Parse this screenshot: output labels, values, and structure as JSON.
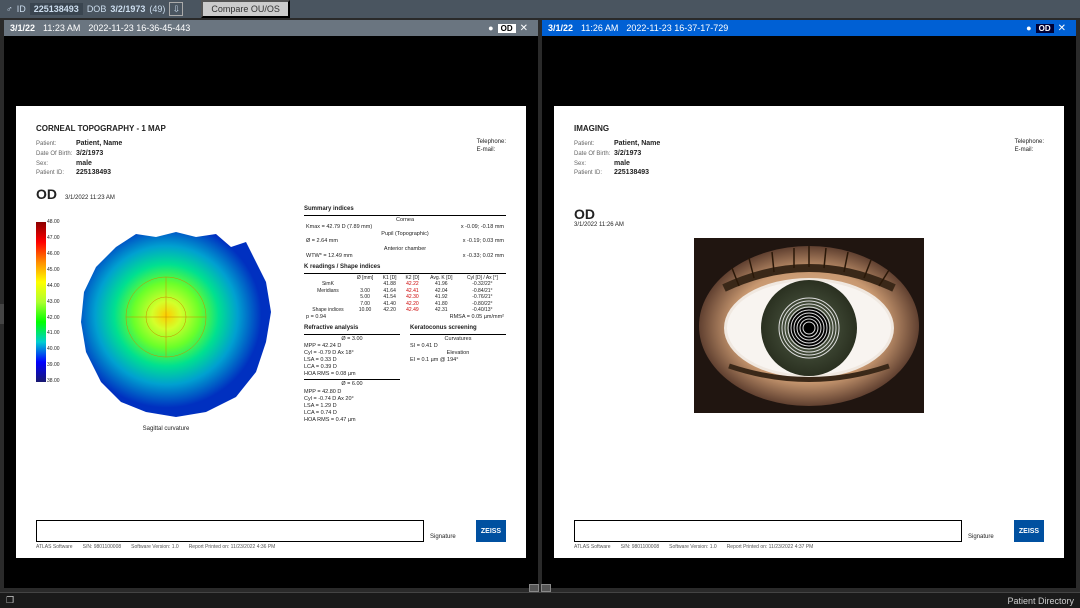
{
  "topbar": {
    "gender_icon": "♂",
    "id_label": "ID",
    "id": "225138493",
    "dob_label": "DOB",
    "dob": "3/2/1973",
    "age": "(49)",
    "compare_btn": "Compare OU/OS"
  },
  "panel1": {
    "tab_date": "3/1/22",
    "tab_time": "11:23 AM",
    "tab_file": "2022-11-23 16-36-45-443",
    "eye_ind": "OD",
    "report": {
      "title": "CORNEAL TOPOGRAPHY - 1 MAP",
      "patient_label": "Patient:",
      "patient": "Patient, Name",
      "dob_label": "Date Of Birth:",
      "dob": "3/2/1973",
      "sex_label": "Sex:",
      "sex": "male",
      "pid_label": "Patient ID:",
      "pid": "225138493",
      "tel_label": "Telephone:",
      "email_label": "E-mail:",
      "eye": "OD",
      "ts": "3/1/2022 11:23 AM",
      "colorbar": [
        "48.00",
        "47.00",
        "46.00",
        "45.00",
        "44.00",
        "43.00",
        "42.00",
        "41.00",
        "40.00",
        "39.00",
        "38.00"
      ],
      "summary": {
        "title": "Summary indices",
        "cornea": "Cornea",
        "kmax": "Kmax = 42.79 D (7.89 mm)",
        "kmax_v": "x -0.09; -0.18 mm",
        "pupil": "Pupil (Topographic)",
        "diam": "Ø = 2.64 mm",
        "diam_v": "x -0.19; 0.03 mm",
        "ant": "Anterior chamber",
        "wtw": "WTW* = 12.49 mm",
        "wtw_v": "x -0.33; 0.02 mm"
      },
      "kread": {
        "title": "K readings / Shape indices",
        "headers": [
          "",
          "Ø [mm]",
          "K1 [D]",
          "K2 [D]",
          "Avg. K [D]",
          "Cyl [D] / Ax [°]"
        ],
        "rows": [
          [
            "SimK",
            "",
            "41.88",
            "42.22",
            "41.96",
            "-0.32/22°"
          ],
          [
            "Meridians",
            "3.00",
            "41.64",
            "42.41",
            "42.04",
            "-0.84/21°"
          ],
          [
            "",
            "5.00",
            "41.54",
            "42.30",
            "41.92",
            "-0.76/21°"
          ],
          [
            "",
            "7.00",
            "41.40",
            "42.20",
            "41.80",
            "-0.80/22°"
          ],
          [
            "Shape indices",
            "10.00",
            "42.20",
            "42.49",
            "42.31",
            "-0.40/13°"
          ]
        ],
        "p": "p = 0.94",
        "rms": "RMSA = 0.05 µm/mm²"
      },
      "refract": {
        "title": "Refractive analysis",
        "d3": "Ø = 3.00",
        "mpp": "MPP = 42.24 D",
        "cyl": "Cyl = -0.79 D Ax 18°",
        "lsa": "LSA = 0.33 D",
        "lca": "LCA = 0.39 D",
        "hoa": "HOA RMS = 0.08 µm",
        "d6": "Ø = 6.00",
        "mpp6": "MPP = 42.80 D",
        "cyl6": "Cyl = -0.74 D Ax 20°",
        "lsa6": "LSA = 1.29 D",
        "lca6": "LCA = 0.74 D",
        "hoa6": "HOA RMS = 0.47 µm"
      },
      "kerato": {
        "title": "Keratoconus screening",
        "curv": "Curvatures",
        "si": "SI  = 0.41 D",
        "elev": "Elevation",
        "ei": "EI  = 0.1 µm @ 194°"
      },
      "sag": "Sagittal curvature",
      "sig": "Signature",
      "footer": {
        "sw": "ATLAS Software",
        "sn": "S/N: 9801100008",
        "ver": "Software Version: 1.0",
        "printed": "Report Printed on: 11/23/2022 4:36 PM"
      }
    }
  },
  "panel2": {
    "tab_date": "3/1/22",
    "tab_time": "11:26 AM",
    "tab_file": "2022-11-23 16-37-17-729",
    "eye_ind": "OD",
    "report": {
      "title": "IMAGING",
      "patient_label": "Patient:",
      "patient": "Patient, Name",
      "dob_label": "Date Of Birth:",
      "dob": "3/2/1973",
      "sex_label": "Sex:",
      "sex": "male",
      "pid_label": "Patient ID:",
      "pid": "225138493",
      "tel_label": "Telephone:",
      "email_label": "E-mail:",
      "eye": "OD",
      "ts": "3/1/2022 11:26 AM",
      "sig": "Signature",
      "footer": {
        "sw": "ATLAS Software",
        "sn": "S/N: 9801100008",
        "ver": "Software Version: 1.0",
        "printed": "Report Printed on: 11/23/2022 4:37 PM"
      }
    }
  },
  "bottombar": {
    "directory": "Patient Directory"
  },
  "zeiss": "ZEISS"
}
